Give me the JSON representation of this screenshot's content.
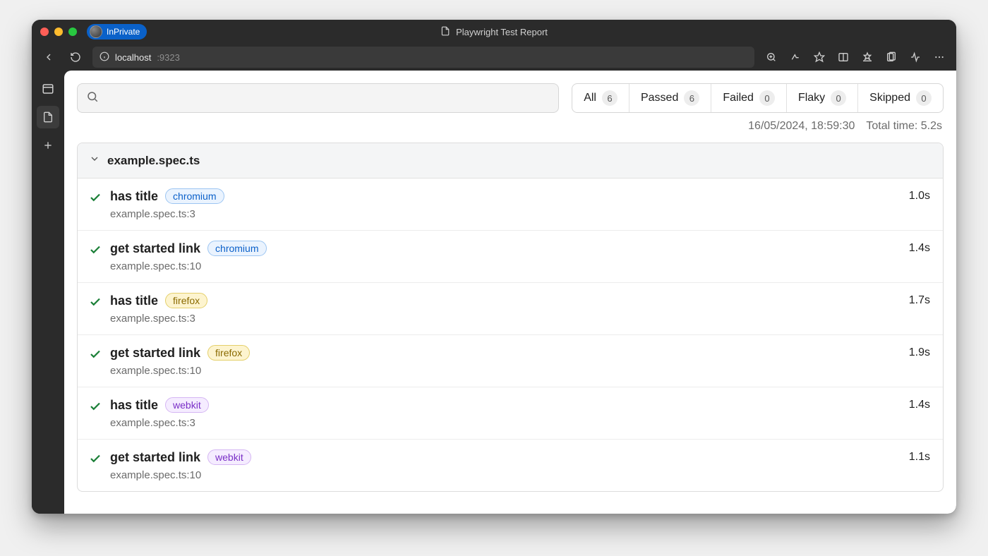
{
  "browser": {
    "inprivate_label": "InPrivate",
    "page_title": "Playwright Test Report",
    "url_host": "localhost",
    "url_port": ":9323"
  },
  "search": {
    "placeholder": ""
  },
  "filters": [
    {
      "label": "All",
      "count": "6"
    },
    {
      "label": "Passed",
      "count": "6"
    },
    {
      "label": "Failed",
      "count": "0"
    },
    {
      "label": "Flaky",
      "count": "0"
    },
    {
      "label": "Skipped",
      "count": "0"
    }
  ],
  "meta": {
    "timestamp": "16/05/2024, 18:59:30",
    "total_time": "Total time: 5.2s"
  },
  "file": {
    "name": "example.spec.ts",
    "tests": [
      {
        "name": "has title",
        "project": "chromium",
        "location": "example.spec.ts:3",
        "duration": "1.0s"
      },
      {
        "name": "get started link",
        "project": "chromium",
        "location": "example.spec.ts:10",
        "duration": "1.4s"
      },
      {
        "name": "has title",
        "project": "firefox",
        "location": "example.spec.ts:3",
        "duration": "1.7s"
      },
      {
        "name": "get started link",
        "project": "firefox",
        "location": "example.spec.ts:10",
        "duration": "1.9s"
      },
      {
        "name": "has title",
        "project": "webkit",
        "location": "example.spec.ts:3",
        "duration": "1.4s"
      },
      {
        "name": "get started link",
        "project": "webkit",
        "location": "example.spec.ts:10",
        "duration": "1.1s"
      }
    ]
  }
}
